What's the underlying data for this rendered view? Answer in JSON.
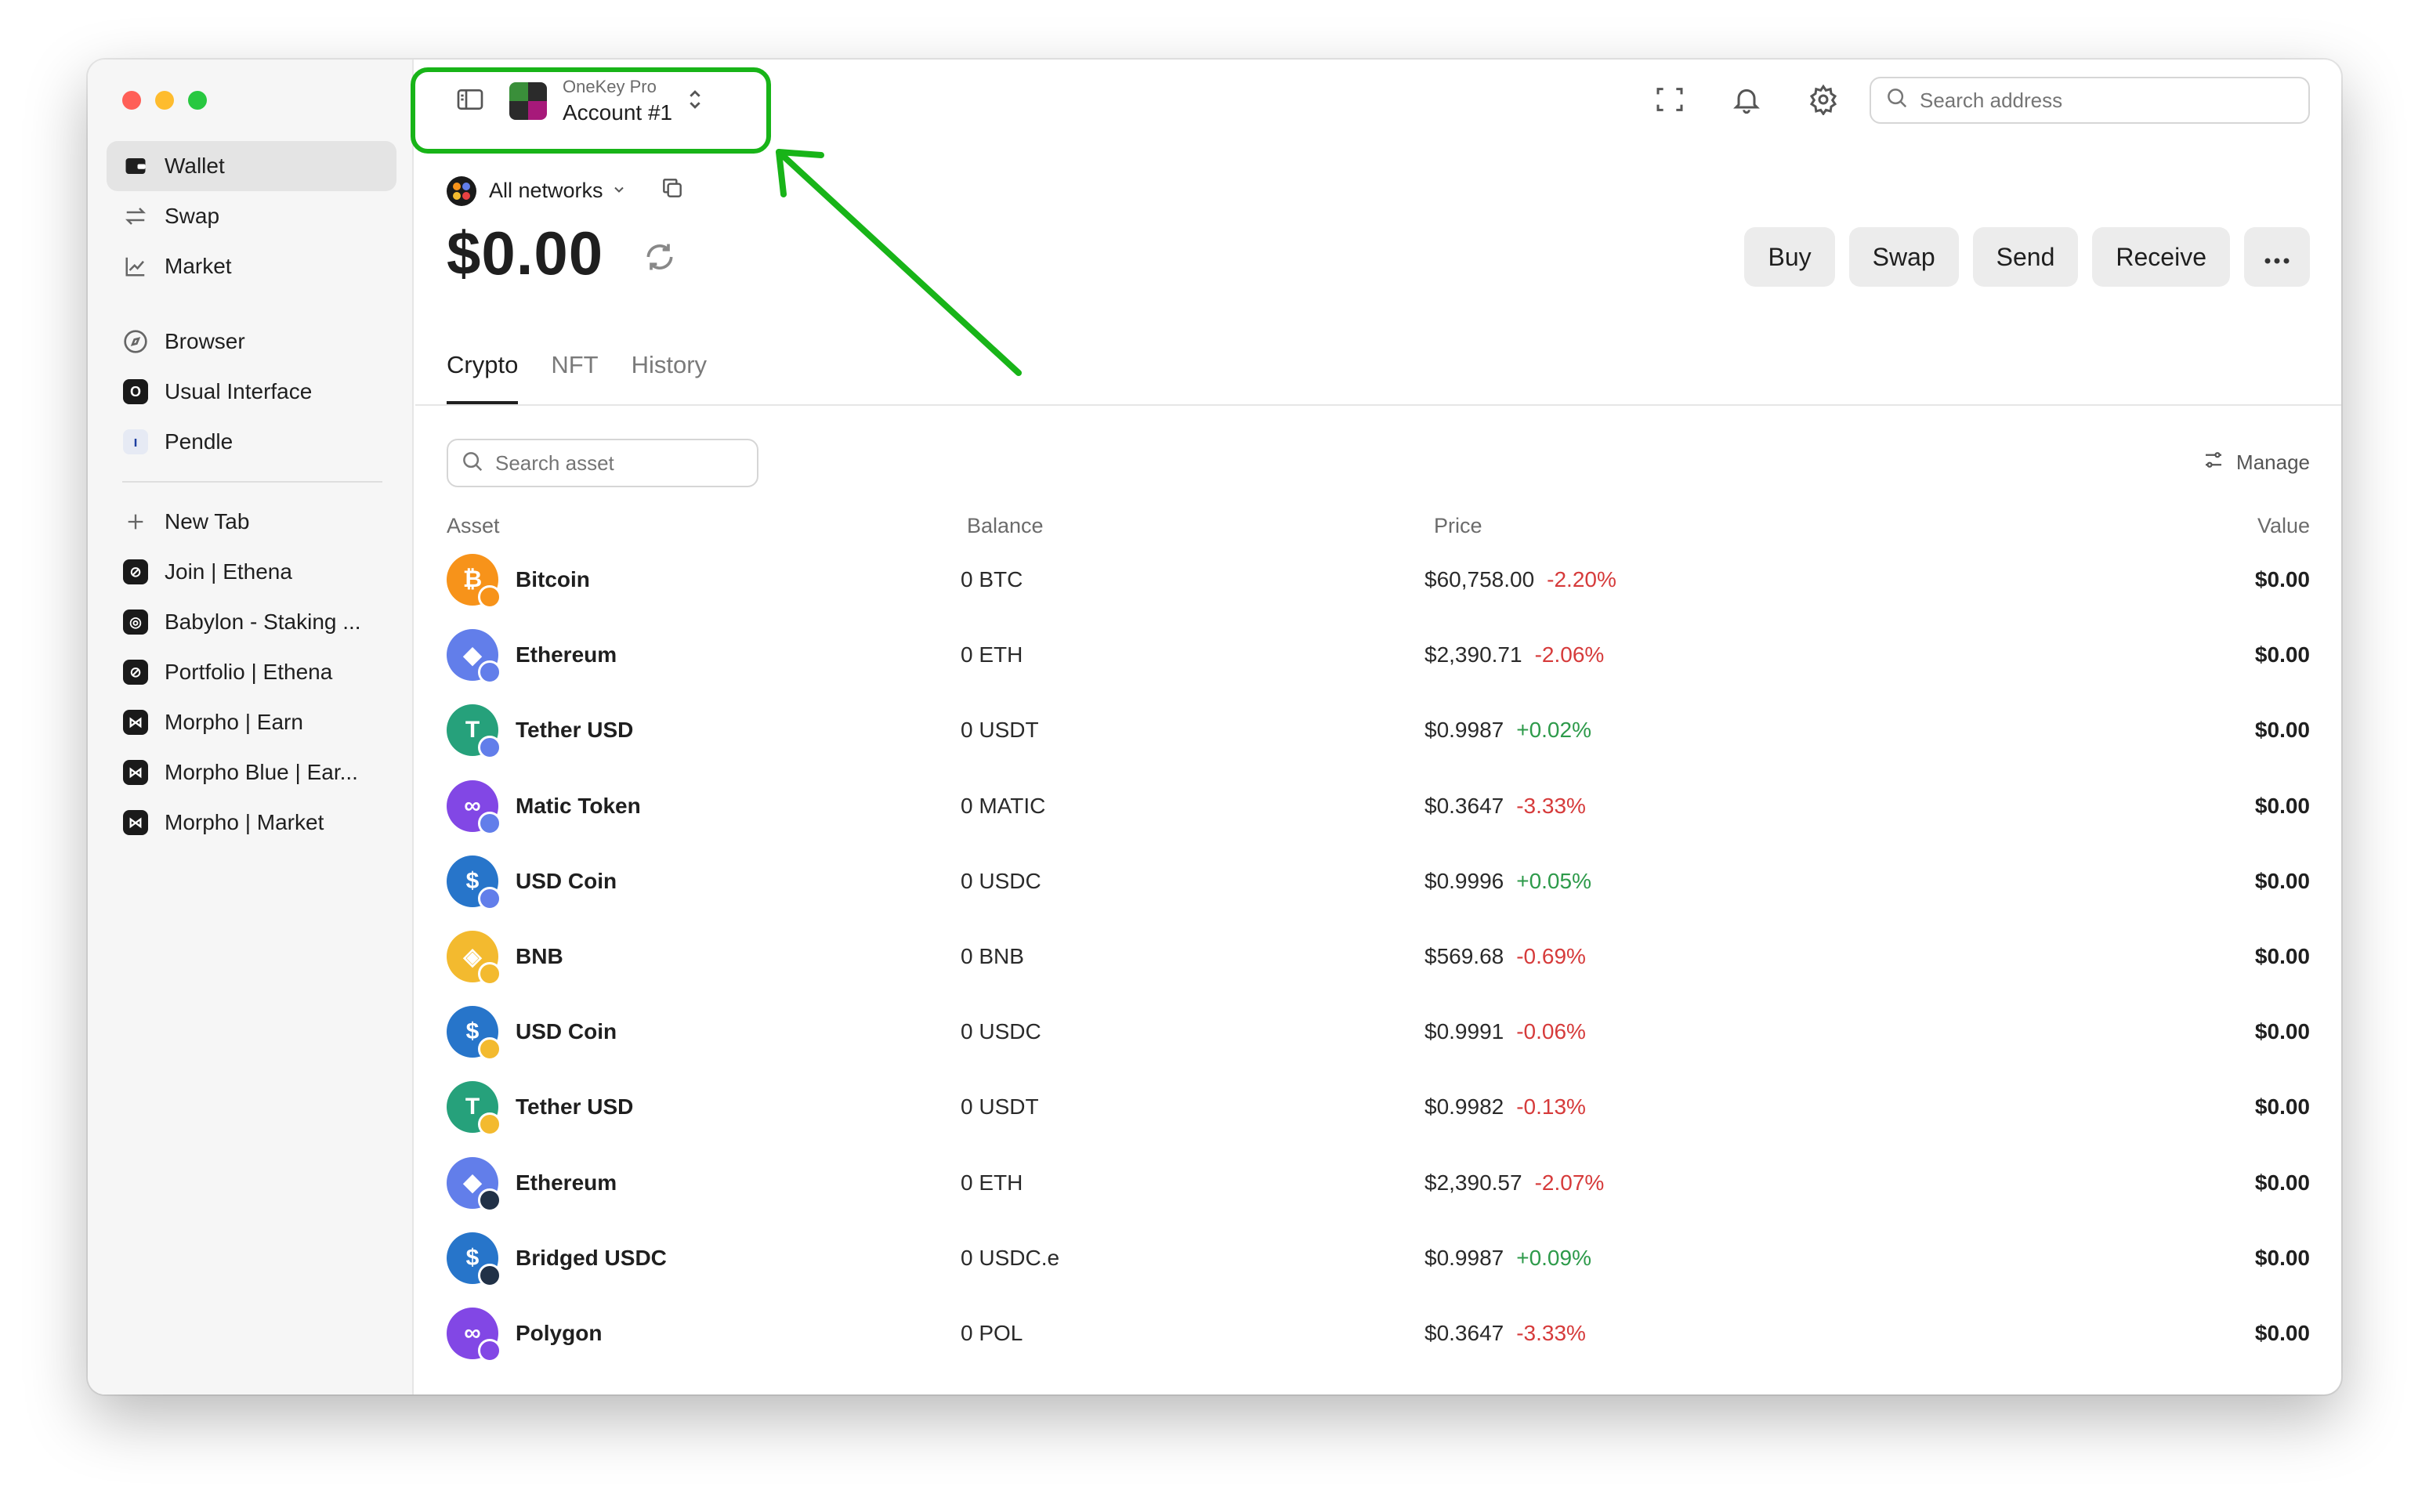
{
  "colors": {
    "accent_green": "#18b418",
    "negative": "#d63b3b",
    "positive": "#2d9a4a"
  },
  "sidebar": {
    "items": [
      {
        "label": "Wallet",
        "icon": "wallet-icon",
        "active": true
      },
      {
        "label": "Swap",
        "icon": "swap-arrows-icon"
      },
      {
        "label": "Market",
        "icon": "chart-line-icon"
      }
    ],
    "apps": [
      {
        "label": "Browser",
        "icon": "compass-icon"
      },
      {
        "label": "Usual Interface",
        "icon": "usual-favicon"
      },
      {
        "label": "Pendle",
        "icon": "pendle-favicon"
      }
    ],
    "tabs": [
      {
        "label": "New Tab",
        "icon": "plus-icon"
      },
      {
        "label": "Join | Ethena",
        "icon": "ethena-favicon"
      },
      {
        "label": "Babylon - Staking ...",
        "icon": "babylon-favicon"
      },
      {
        "label": "Portfolio | Ethena",
        "icon": "ethena-favicon"
      },
      {
        "label": "Morpho | Earn",
        "icon": "morpho-favicon"
      },
      {
        "label": "Morpho Blue | Ear...",
        "icon": "morpho-favicon"
      },
      {
        "label": "Morpho | Market",
        "icon": "morpho-favicon"
      }
    ]
  },
  "header": {
    "device": "OneKey Pro",
    "account": "Account #1",
    "search_placeholder": "Search address"
  },
  "wallet": {
    "network": "All networks",
    "balance": "$0.00",
    "actions": [
      "Buy",
      "Swap",
      "Send",
      "Receive"
    ],
    "tabs": [
      "Crypto",
      "NFT",
      "History"
    ],
    "search_asset_placeholder": "Search asset",
    "manage_label": "Manage"
  },
  "table": {
    "columns": [
      "Asset",
      "Balance",
      "Price",
      "Value"
    ],
    "rows": [
      {
        "name": "Bitcoin",
        "balance": "0 BTC",
        "price": "$60,758.00",
        "change": "-2.20%",
        "value": "$0.00",
        "coin_color": "#f7931a",
        "glyph": "₿",
        "badge_color": "#f7931a"
      },
      {
        "name": "Ethereum",
        "balance": "0 ETH",
        "price": "$2,390.71",
        "change": "-2.06%",
        "value": "$0.00",
        "coin_color": "#627eea",
        "glyph": "◆",
        "badge_color": "#627eea"
      },
      {
        "name": "Tether USD",
        "balance": "0 USDT",
        "price": "$0.9987",
        "change": "+0.02%",
        "value": "$0.00",
        "coin_color": "#26a17b",
        "glyph": "T",
        "badge_color": "#627eea"
      },
      {
        "name": "Matic Token",
        "balance": "0 MATIC",
        "price": "$0.3647",
        "change": "-3.33%",
        "value": "$0.00",
        "coin_color": "#8247e5",
        "glyph": "∞",
        "badge_color": "#627eea"
      },
      {
        "name": "USD Coin",
        "balance": "0 USDC",
        "price": "$0.9996",
        "change": "+0.05%",
        "value": "$0.00",
        "coin_color": "#2775ca",
        "glyph": "$",
        "badge_color": "#627eea"
      },
      {
        "name": "BNB",
        "balance": "0 BNB",
        "price": "$569.68",
        "change": "-0.69%",
        "value": "$0.00",
        "coin_color": "#f3ba2f",
        "glyph": "◈",
        "badge_color": "#f3ba2f"
      },
      {
        "name": "USD Coin",
        "balance": "0 USDC",
        "price": "$0.9991",
        "change": "-0.06%",
        "value": "$0.00",
        "coin_color": "#2775ca",
        "glyph": "$",
        "badge_color": "#f3ba2f"
      },
      {
        "name": "Tether USD",
        "balance": "0 USDT",
        "price": "$0.9982",
        "change": "-0.13%",
        "value": "$0.00",
        "coin_color": "#26a17b",
        "glyph": "T",
        "badge_color": "#f3ba2f"
      },
      {
        "name": "Ethereum",
        "balance": "0 ETH",
        "price": "$2,390.57",
        "change": "-2.07%",
        "value": "$0.00",
        "coin_color": "#627eea",
        "glyph": "◆",
        "badge_color": "#213147"
      },
      {
        "name": "Bridged USDC",
        "balance": "0 USDC.e",
        "price": "$0.9987",
        "change": "+0.09%",
        "value": "$0.00",
        "coin_color": "#2775ca",
        "glyph": "$",
        "badge_color": "#213147"
      },
      {
        "name": "Polygon",
        "balance": "0 POL",
        "price": "$0.3647",
        "change": "-3.33%",
        "value": "$0.00",
        "coin_color": "#8247e5",
        "glyph": "∞",
        "badge_color": "#8247e5"
      }
    ]
  }
}
